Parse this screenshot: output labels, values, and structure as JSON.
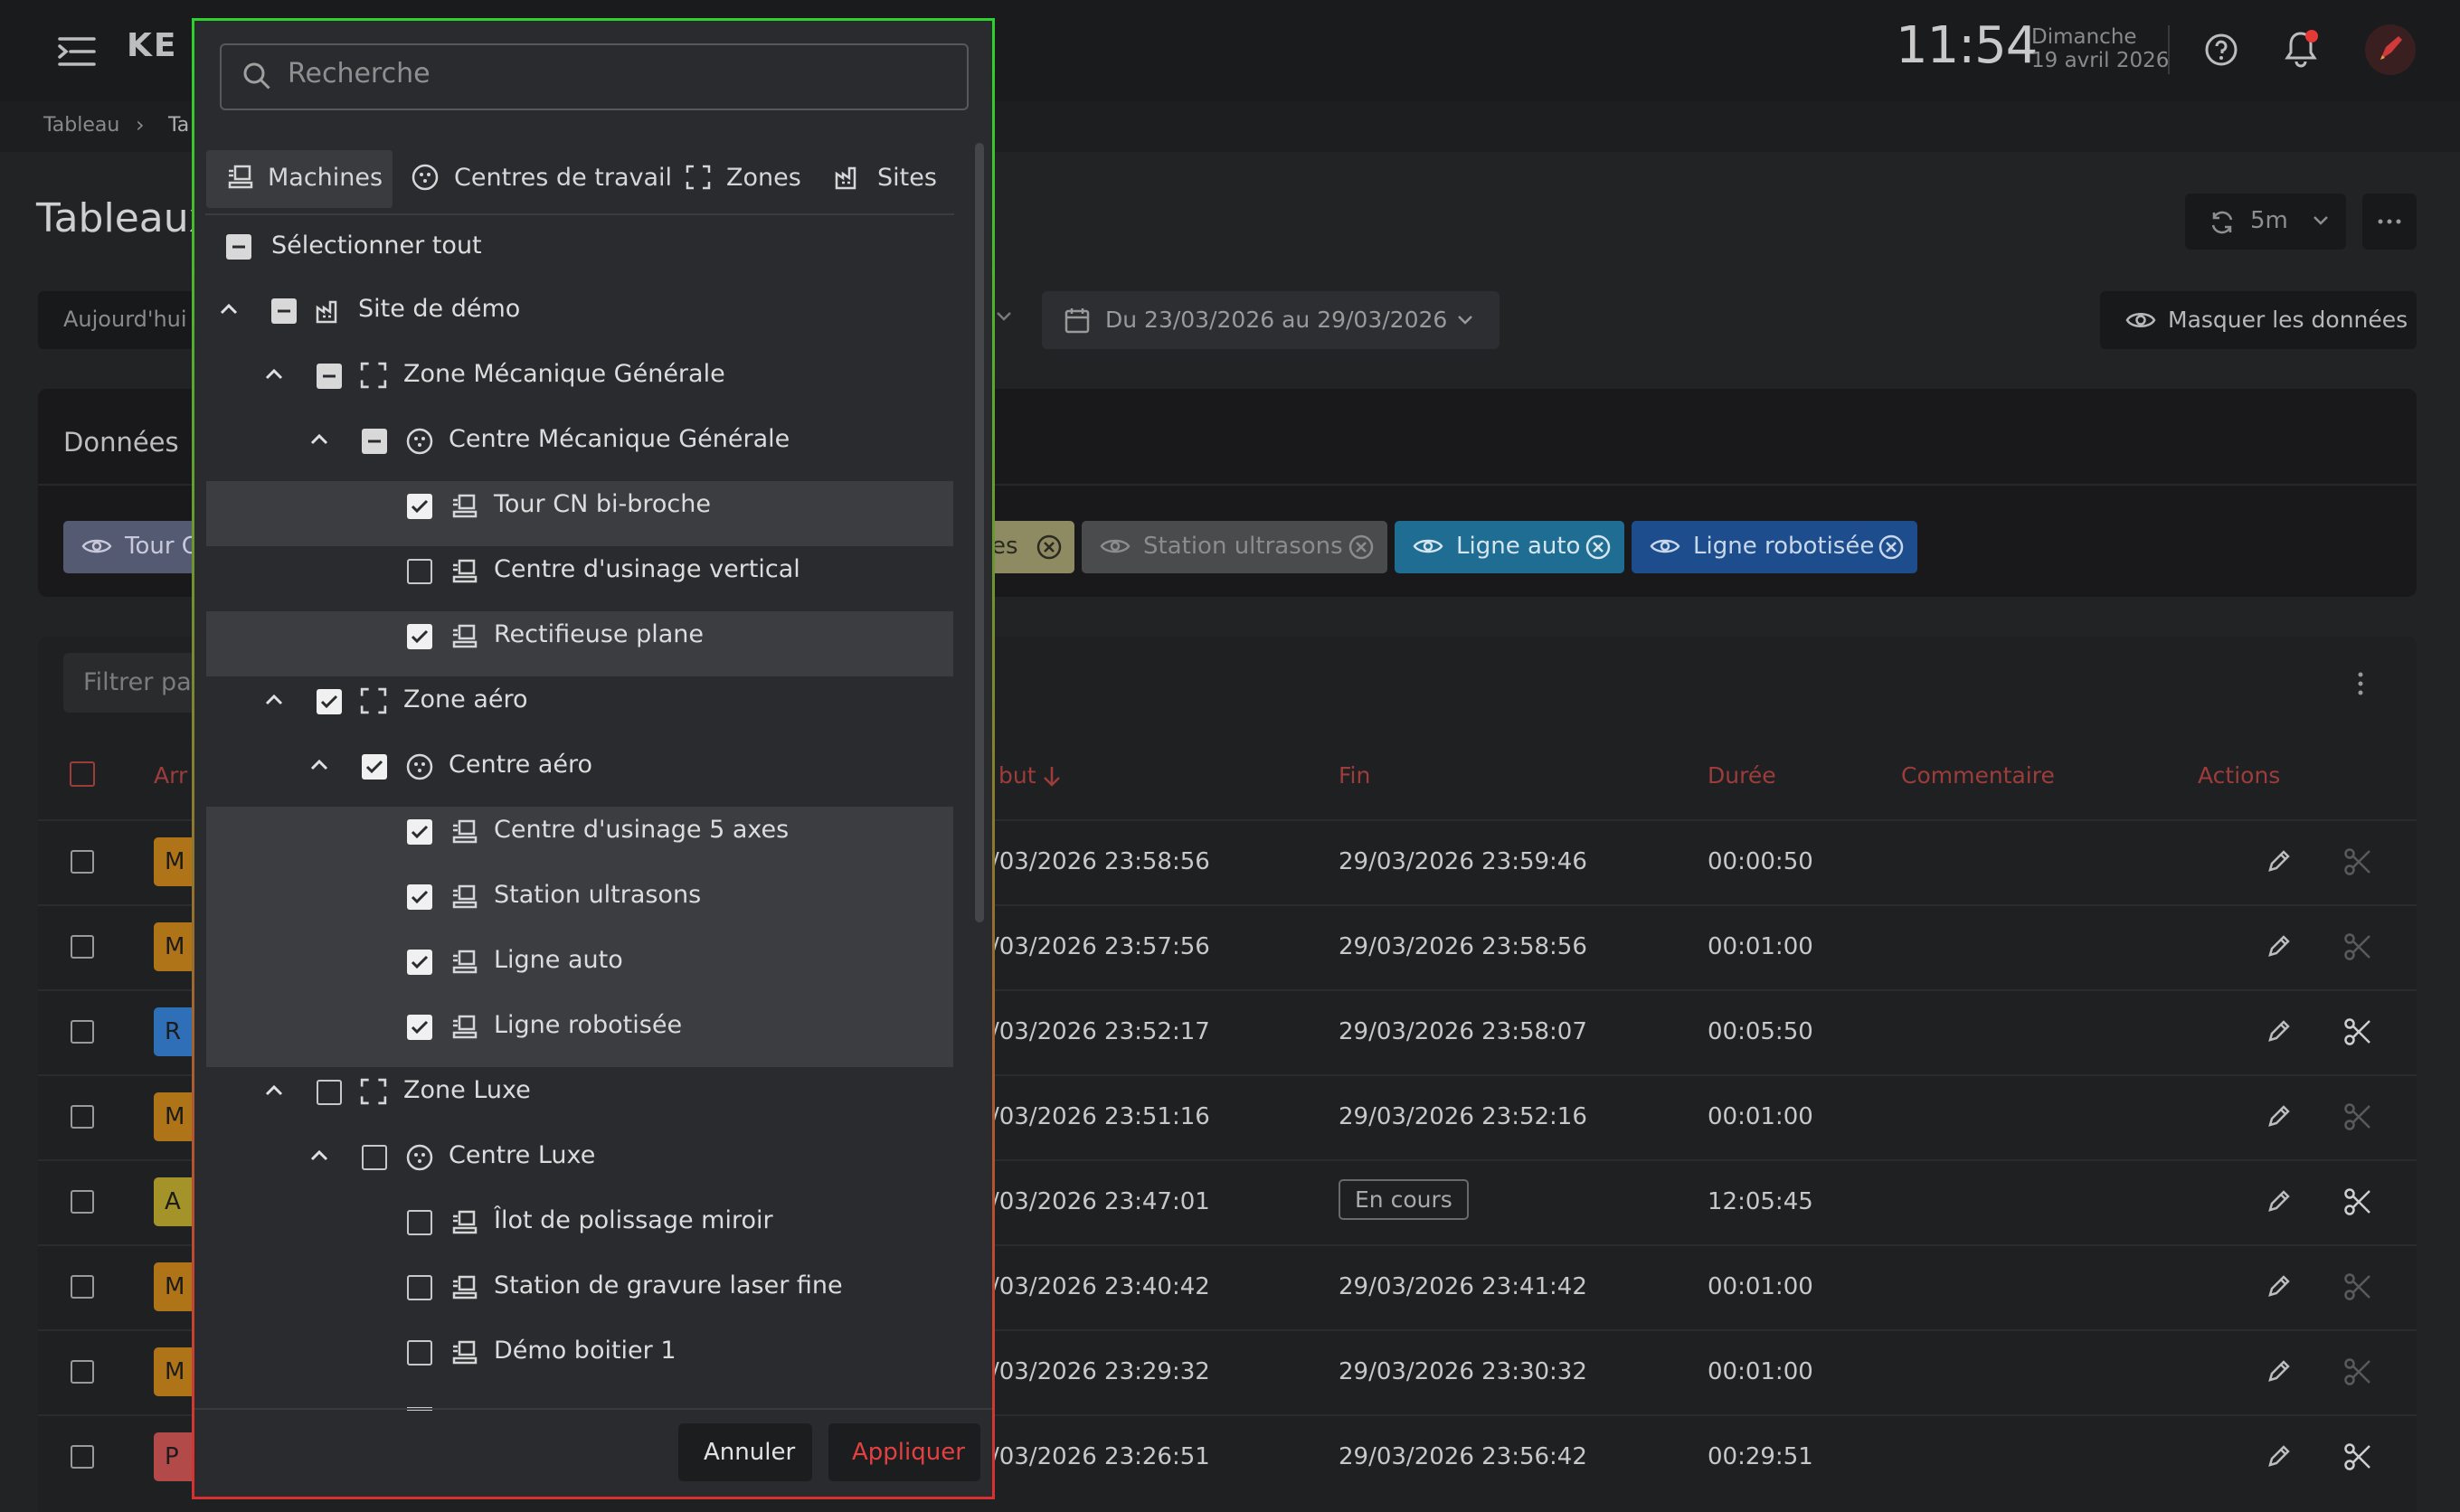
{
  "header": {
    "time": "11:54",
    "day": "Dimanche",
    "date": "19 avril 2026",
    "logo_fragment": "KE",
    "notification_dot_color": "#e53935"
  },
  "breadcrumb": {
    "items": [
      "Tableau",
      "Ta"
    ]
  },
  "page": {
    "title": "Tableaux",
    "refresh_label": "5m",
    "today_label": "Aujourd'hui",
    "date_range": "Du 23/03/2026 au 29/03/2026",
    "hide_data_label": "Masquer les données"
  },
  "data_panel": {
    "title": "Données",
    "chips": [
      {
        "label": "Tour C",
        "color": "#555a73"
      },
      {
        "label": "es",
        "color": "#8e8a62"
      },
      {
        "label": "Station ultrasons",
        "color": "#4a4b4d"
      },
      {
        "label": "Ligne auto",
        "color": "#1f6d93"
      },
      {
        "label": "Ligne robotisée",
        "color": "#1d4d8c"
      }
    ]
  },
  "table": {
    "filter_placeholder": "Filtrer pa",
    "columns": [
      "Arr",
      "but",
      "Fin",
      "Durée",
      "Commentaire",
      "Actions"
    ],
    "rows": [
      {
        "badge": "M",
        "badge_color": "#b07418",
        "debut": "/03/2026 23:58:56",
        "fin": "29/03/2026 23:59:46",
        "duree": "00:00:50",
        "cut_enabled": false
      },
      {
        "badge": "M",
        "badge_color": "#b07418",
        "debut": "/03/2026 23:57:56",
        "fin": "29/03/2026 23:58:56",
        "duree": "00:01:00",
        "cut_enabled": false
      },
      {
        "badge": "R",
        "badge_color": "#2f6fb8",
        "debut": "/03/2026 23:52:17",
        "fin": "29/03/2026 23:58:07",
        "duree": "00:05:50",
        "cut_enabled": true
      },
      {
        "badge": "M",
        "badge_color": "#b07418",
        "debut": "/03/2026 23:51:16",
        "fin": "29/03/2026 23:52:16",
        "duree": "00:01:00",
        "cut_enabled": false
      },
      {
        "badge": "A",
        "badge_color": "#a39328",
        "debut": "/03/2026 23:47:01",
        "fin": "En cours",
        "duree": "12:05:45",
        "cut_enabled": true
      },
      {
        "badge": "M",
        "badge_color": "#b07418",
        "debut": "/03/2026 23:40:42",
        "fin": "29/03/2026 23:41:42",
        "duree": "00:01:00",
        "cut_enabled": false
      },
      {
        "badge": "M",
        "badge_color": "#b07418",
        "debut": "/03/2026 23:29:32",
        "fin": "29/03/2026 23:30:32",
        "duree": "00:01:00",
        "cut_enabled": false
      },
      {
        "badge": "P",
        "badge_color": "#b24a4a",
        "debut": "/03/2026 23:26:51",
        "fin": "29/03/2026 23:56:42",
        "duree": "00:29:51",
        "cut_enabled": true
      }
    ]
  },
  "dropdown": {
    "search_placeholder": "Recherche",
    "tabs": [
      {
        "label": "Machines",
        "icon": "machine-icon",
        "active": true
      },
      {
        "label": "Centres de travail",
        "icon": "workcenter-icon",
        "active": false
      },
      {
        "label": "Zones",
        "icon": "zone-icon",
        "active": false
      },
      {
        "label": "Sites",
        "icon": "factory-icon",
        "active": false
      }
    ],
    "select_all": "Sélectionner tout",
    "tree": [
      {
        "label": "Site de démo",
        "type": "site",
        "state": "indeterminate"
      },
      {
        "label": "Zone Mécanique Générale",
        "type": "zone",
        "state": "indeterminate"
      },
      {
        "label": "Centre Mécanique Générale",
        "type": "center",
        "state": "indeterminate"
      },
      {
        "label": "Tour CN bi-broche",
        "type": "machine",
        "state": "checked"
      },
      {
        "label": "Centre d'usinage vertical",
        "type": "machine",
        "state": "unchecked"
      },
      {
        "label": "Rectifieuse plane",
        "type": "machine",
        "state": "checked"
      },
      {
        "label": "Zone aéro",
        "type": "zone",
        "state": "checked"
      },
      {
        "label": "Centre aéro",
        "type": "center",
        "state": "checked"
      },
      {
        "label": "Centre d'usinage 5 axes",
        "type": "machine",
        "state": "checked"
      },
      {
        "label": "Station ultrasons",
        "type": "machine",
        "state": "checked"
      },
      {
        "label": "Ligne auto",
        "type": "machine",
        "state": "checked"
      },
      {
        "label": "Ligne robotisée",
        "type": "machine",
        "state": "checked"
      },
      {
        "label": "Zone Luxe",
        "type": "zone",
        "state": "unchecked"
      },
      {
        "label": "Centre Luxe",
        "type": "center",
        "state": "unchecked"
      },
      {
        "label": "Îlot de polissage miroir",
        "type": "machine",
        "state": "unchecked"
      },
      {
        "label": "Station de gravure laser fine",
        "type": "machine",
        "state": "unchecked"
      },
      {
        "label": "Démo boitier 1",
        "type": "machine",
        "state": "unchecked"
      }
    ],
    "cancel_label": "Annuler",
    "apply_label": "Appliquer"
  }
}
